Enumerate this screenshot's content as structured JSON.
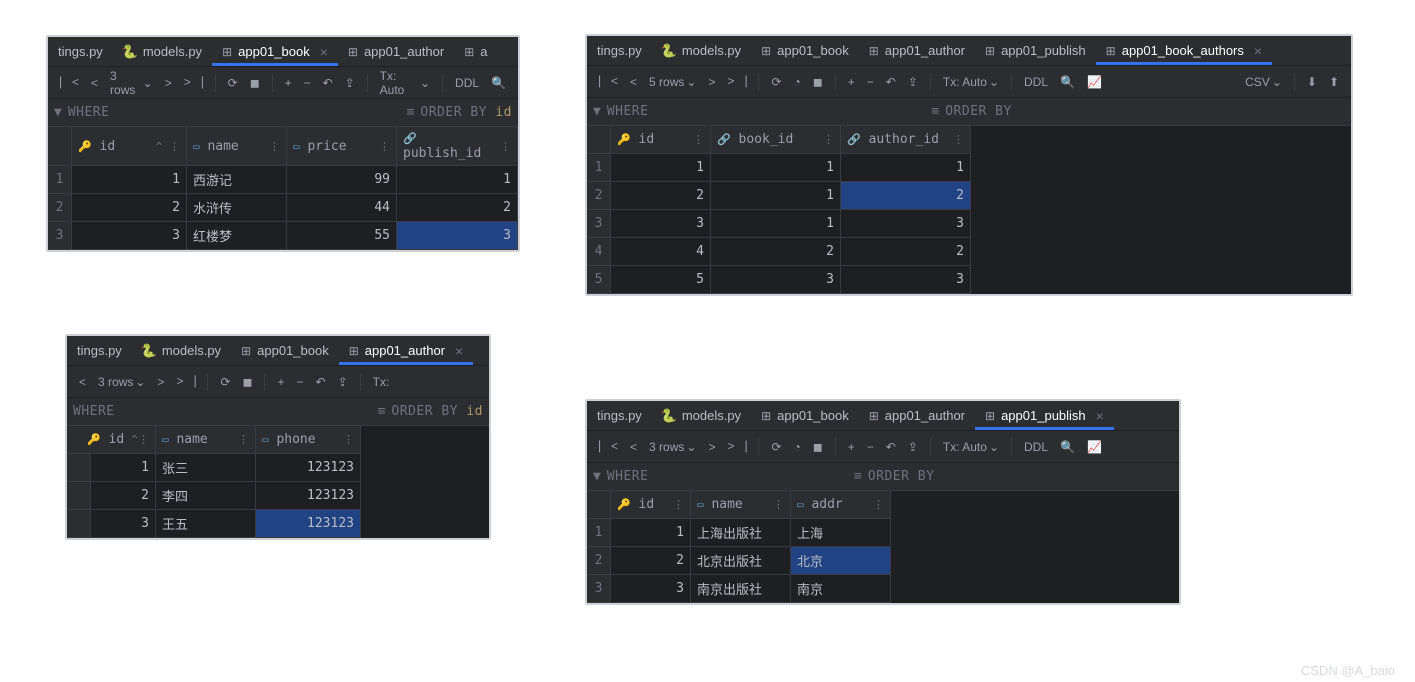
{
  "book_panel": {
    "tabs": [
      "tings.py",
      "models.py",
      "app01_book",
      "app01_author"
    ],
    "active_tab": "app01_book",
    "rows_label": "3 rows",
    "tx_label": "Tx: Auto",
    "ddl_label": "DDL",
    "where": "WHERE",
    "order_by": "ORDER BY",
    "order_col": "id",
    "columns": [
      "id",
      "name",
      "price",
      "publish_id"
    ],
    "data": [
      [
        "1",
        "西游记",
        "99",
        "1"
      ],
      [
        "2",
        "水浒传",
        "44",
        "2"
      ],
      [
        "3",
        "红楼梦",
        "55",
        "3"
      ]
    ]
  },
  "book_authors_panel": {
    "tabs": [
      "tings.py",
      "models.py",
      "app01_book",
      "app01_author",
      "app01_publish",
      "app01_book_authors"
    ],
    "active_tab": "app01_book_authors",
    "rows_label": "5 rows",
    "tx_label": "Tx: Auto",
    "ddl_label": "DDL",
    "csv_label": "CSV",
    "where": "WHERE",
    "order_by": "ORDER BY",
    "columns": [
      "id",
      "book_id",
      "author_id"
    ],
    "data": [
      [
        "1",
        "1",
        "1"
      ],
      [
        "2",
        "1",
        "2"
      ],
      [
        "3",
        "1",
        "3"
      ],
      [
        "4",
        "2",
        "2"
      ],
      [
        "5",
        "3",
        "3"
      ]
    ]
  },
  "author_panel": {
    "tabs": [
      "tings.py",
      "models.py",
      "app01_book",
      "app01_author"
    ],
    "active_tab": "app01_author",
    "rows_label": "3 rows",
    "tx_label": "Tx:",
    "where": "WHERE",
    "order_by": "ORDER BY",
    "order_col": "id",
    "columns": [
      "id",
      "name",
      "phone"
    ],
    "data": [
      [
        "1",
        "张三",
        "123123"
      ],
      [
        "2",
        "李四",
        "123123"
      ],
      [
        "3",
        "王五",
        "123123"
      ]
    ]
  },
  "publish_panel": {
    "tabs": [
      "tings.py",
      "models.py",
      "app01_book",
      "app01_author",
      "app01_publish"
    ],
    "active_tab": "app01_publish",
    "rows_label": "3 rows",
    "tx_label": "Tx: Auto",
    "ddl_label": "DDL",
    "where": "WHERE",
    "order_by": "ORDER BY",
    "columns": [
      "id",
      "name",
      "addr"
    ],
    "data": [
      [
        "1",
        "上海出版社",
        "上海"
      ],
      [
        "2",
        "北京出版社",
        "北京"
      ],
      [
        "3",
        "南京出版社",
        "南京"
      ]
    ]
  },
  "watermark": "CSDN @A_baio"
}
